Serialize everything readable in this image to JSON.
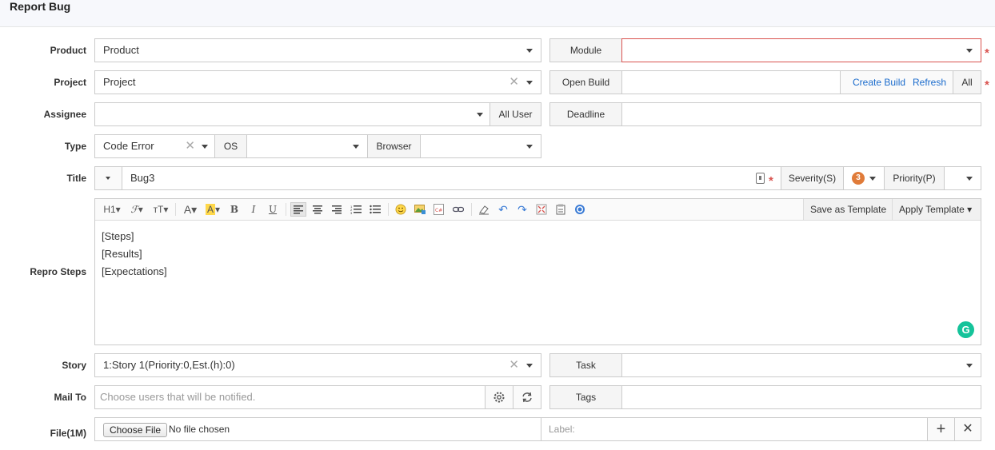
{
  "page_title": "Report Bug",
  "labels": {
    "product": "Product",
    "project": "Project",
    "assignee": "Assignee",
    "type": "Type",
    "title": "Title",
    "repro_steps": "Repro Steps",
    "story": "Story",
    "mail_to": "Mail To",
    "file": "File(1M)"
  },
  "product": {
    "value": "Product"
  },
  "module": {
    "label": "Module",
    "value": ""
  },
  "project": {
    "value": "Project"
  },
  "open_build": {
    "label": "Open Build",
    "value": "",
    "create_build": "Create Build",
    "refresh": "Refresh",
    "all": "All"
  },
  "assignee": {
    "value": "",
    "all_user": "All User"
  },
  "deadline": {
    "label": "Deadline",
    "value": ""
  },
  "type": {
    "value": "Code Error",
    "os_label": "OS",
    "os_value": "",
    "browser_label": "Browser",
    "browser_value": ""
  },
  "title": {
    "value": "Bug3",
    "severity_label": "Severity(S)",
    "severity_value": "3",
    "priority_label": "Priority(P)",
    "priority_value": ""
  },
  "editor": {
    "toolbar": {
      "heading": "H1",
      "font": "ℱ",
      "size": "тT",
      "font_color": "A",
      "bg_color": "A",
      "bold": "B",
      "italic": "I",
      "underline": "U"
    },
    "save_template": "Save as Template",
    "apply_template": "Apply Template",
    "lines": [
      "[Steps]",
      "[Results]",
      "[Expectations]"
    ],
    "grammarly": "G"
  },
  "story": {
    "value": "1:Story 1(Priority:0,Est.(h):0)"
  },
  "task": {
    "label": "Task",
    "value": ""
  },
  "mail_to": {
    "placeholder": "Choose users that will be notified."
  },
  "tags": {
    "label": "Tags",
    "value": ""
  },
  "file": {
    "choose_button": "Choose File",
    "status": "No file chosen",
    "label_placeholder": "Label:"
  },
  "colors": {
    "required": "#d9534f",
    "link": "#1a6bcc",
    "severity": "#e07b39",
    "grammarly": "#15c39a"
  }
}
